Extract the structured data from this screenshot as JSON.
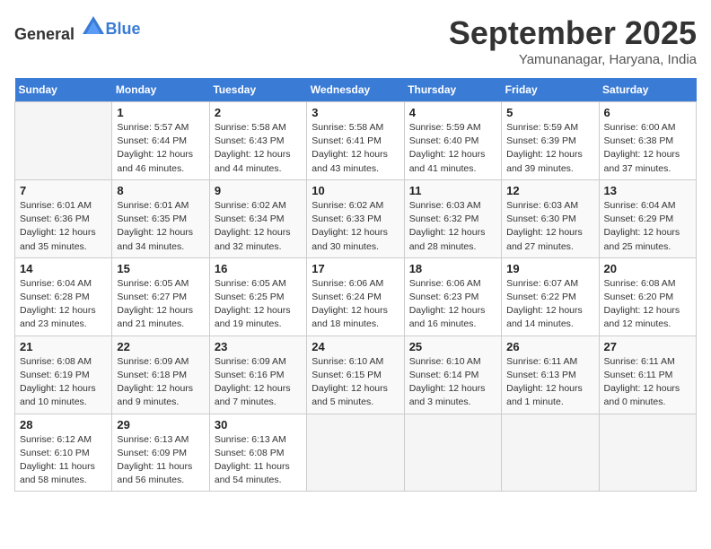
{
  "header": {
    "logo_general": "General",
    "logo_blue": "Blue",
    "month": "September 2025",
    "location": "Yamunanagar, Haryana, India"
  },
  "days_of_week": [
    "Sunday",
    "Monday",
    "Tuesday",
    "Wednesday",
    "Thursday",
    "Friday",
    "Saturday"
  ],
  "weeks": [
    [
      {
        "day": "",
        "info": ""
      },
      {
        "day": "1",
        "info": "Sunrise: 5:57 AM\nSunset: 6:44 PM\nDaylight: 12 hours\nand 46 minutes."
      },
      {
        "day": "2",
        "info": "Sunrise: 5:58 AM\nSunset: 6:43 PM\nDaylight: 12 hours\nand 44 minutes."
      },
      {
        "day": "3",
        "info": "Sunrise: 5:58 AM\nSunset: 6:41 PM\nDaylight: 12 hours\nand 43 minutes."
      },
      {
        "day": "4",
        "info": "Sunrise: 5:59 AM\nSunset: 6:40 PM\nDaylight: 12 hours\nand 41 minutes."
      },
      {
        "day": "5",
        "info": "Sunrise: 5:59 AM\nSunset: 6:39 PM\nDaylight: 12 hours\nand 39 minutes."
      },
      {
        "day": "6",
        "info": "Sunrise: 6:00 AM\nSunset: 6:38 PM\nDaylight: 12 hours\nand 37 minutes."
      }
    ],
    [
      {
        "day": "7",
        "info": "Sunrise: 6:01 AM\nSunset: 6:36 PM\nDaylight: 12 hours\nand 35 minutes."
      },
      {
        "day": "8",
        "info": "Sunrise: 6:01 AM\nSunset: 6:35 PM\nDaylight: 12 hours\nand 34 minutes."
      },
      {
        "day": "9",
        "info": "Sunrise: 6:02 AM\nSunset: 6:34 PM\nDaylight: 12 hours\nand 32 minutes."
      },
      {
        "day": "10",
        "info": "Sunrise: 6:02 AM\nSunset: 6:33 PM\nDaylight: 12 hours\nand 30 minutes."
      },
      {
        "day": "11",
        "info": "Sunrise: 6:03 AM\nSunset: 6:32 PM\nDaylight: 12 hours\nand 28 minutes."
      },
      {
        "day": "12",
        "info": "Sunrise: 6:03 AM\nSunset: 6:30 PM\nDaylight: 12 hours\nand 27 minutes."
      },
      {
        "day": "13",
        "info": "Sunrise: 6:04 AM\nSunset: 6:29 PM\nDaylight: 12 hours\nand 25 minutes."
      }
    ],
    [
      {
        "day": "14",
        "info": "Sunrise: 6:04 AM\nSunset: 6:28 PM\nDaylight: 12 hours\nand 23 minutes."
      },
      {
        "day": "15",
        "info": "Sunrise: 6:05 AM\nSunset: 6:27 PM\nDaylight: 12 hours\nand 21 minutes."
      },
      {
        "day": "16",
        "info": "Sunrise: 6:05 AM\nSunset: 6:25 PM\nDaylight: 12 hours\nand 19 minutes."
      },
      {
        "day": "17",
        "info": "Sunrise: 6:06 AM\nSunset: 6:24 PM\nDaylight: 12 hours\nand 18 minutes."
      },
      {
        "day": "18",
        "info": "Sunrise: 6:06 AM\nSunset: 6:23 PM\nDaylight: 12 hours\nand 16 minutes."
      },
      {
        "day": "19",
        "info": "Sunrise: 6:07 AM\nSunset: 6:22 PM\nDaylight: 12 hours\nand 14 minutes."
      },
      {
        "day": "20",
        "info": "Sunrise: 6:08 AM\nSunset: 6:20 PM\nDaylight: 12 hours\nand 12 minutes."
      }
    ],
    [
      {
        "day": "21",
        "info": "Sunrise: 6:08 AM\nSunset: 6:19 PM\nDaylight: 12 hours\nand 10 minutes."
      },
      {
        "day": "22",
        "info": "Sunrise: 6:09 AM\nSunset: 6:18 PM\nDaylight: 12 hours\nand 9 minutes."
      },
      {
        "day": "23",
        "info": "Sunrise: 6:09 AM\nSunset: 6:16 PM\nDaylight: 12 hours\nand 7 minutes."
      },
      {
        "day": "24",
        "info": "Sunrise: 6:10 AM\nSunset: 6:15 PM\nDaylight: 12 hours\nand 5 minutes."
      },
      {
        "day": "25",
        "info": "Sunrise: 6:10 AM\nSunset: 6:14 PM\nDaylight: 12 hours\nand 3 minutes."
      },
      {
        "day": "26",
        "info": "Sunrise: 6:11 AM\nSunset: 6:13 PM\nDaylight: 12 hours\nand 1 minute."
      },
      {
        "day": "27",
        "info": "Sunrise: 6:11 AM\nSunset: 6:11 PM\nDaylight: 12 hours\nand 0 minutes."
      }
    ],
    [
      {
        "day": "28",
        "info": "Sunrise: 6:12 AM\nSunset: 6:10 PM\nDaylight: 11 hours\nand 58 minutes."
      },
      {
        "day": "29",
        "info": "Sunrise: 6:13 AM\nSunset: 6:09 PM\nDaylight: 11 hours\nand 56 minutes."
      },
      {
        "day": "30",
        "info": "Sunrise: 6:13 AM\nSunset: 6:08 PM\nDaylight: 11 hours\nand 54 minutes."
      },
      {
        "day": "",
        "info": ""
      },
      {
        "day": "",
        "info": ""
      },
      {
        "day": "",
        "info": ""
      },
      {
        "day": "",
        "info": ""
      }
    ]
  ]
}
